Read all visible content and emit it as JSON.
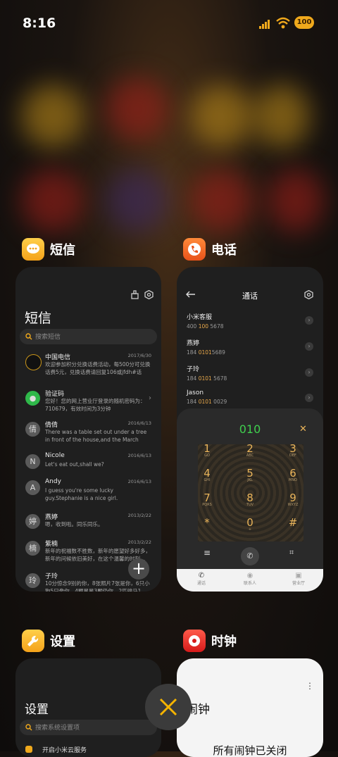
{
  "status": {
    "time": "8:16",
    "battery": "100"
  },
  "apps": {
    "sms": {
      "name": "短信",
      "title": "短信",
      "search_placeholder": "搜索短信",
      "messages": [
        {
          "avatar": "",
          "name": "中国电信",
          "date": "2017/6/30",
          "body": "欢迎参加积分兑换话费活动，每500分可兑换话费5元，兑换话费请回复106或jfdh#话费..."
        },
        {
          "avatar": "",
          "name": "验证码",
          "date": "",
          "body": "您好！您的网上营业厅登录的随机密码为：710679，有效时间为3分钟"
        },
        {
          "avatar": "倩",
          "name": "倩倩",
          "date": "2016/6/13",
          "body": "There was a table set out under a tree in front of the house,and the March Hare an..."
        },
        {
          "avatar": "N",
          "name": "Nicole",
          "date": "2016/6/13",
          "body": "Let's eat out,shall we?"
        },
        {
          "avatar": "A",
          "name": "Andy",
          "date": "2016/6/13",
          "body": "I guess you're some lucky guy.Stephanie is a nice girl."
        },
        {
          "avatar": "婷",
          "name": "燕婷",
          "date": "2013/2/22",
          "body": "嗯，收到啦。同乐同乐。"
        },
        {
          "avatar": "楠",
          "name": "紫楠",
          "date": "2013/2/22",
          "body": "新年的祝福数不胜数，新年的愿望好多好多，新年的问候依旧美好，在这个温馨的时刻..."
        },
        {
          "avatar": "玲",
          "name": "子玲",
          "date": "",
          "body": "10分惊念9别的你，8张照片7张是你，6只小狗5只像你，4颗星星3颗仍你，2匹骏马1..."
        }
      ]
    },
    "phone": {
      "name": "电话",
      "title": "通话",
      "contacts": [
        {
          "name": "小米客服",
          "pre": "400 ",
          "hl": "100",
          "post": " 5678"
        },
        {
          "name": "燕婷",
          "pre": "184 ",
          "hl": "0101",
          "post": "5689"
        },
        {
          "name": "子玲",
          "pre": "184 ",
          "hl": "0101",
          "post": " 5678"
        },
        {
          "name": "Jason",
          "pre": "184 ",
          "hl": "0101",
          "post": " 0029"
        }
      ],
      "dial_number": "010",
      "keys": [
        {
          "d": "1",
          "l": "GO"
        },
        {
          "d": "2",
          "l": "ABC"
        },
        {
          "d": "3",
          "l": "DEF"
        },
        {
          "d": "4",
          "l": "GHI"
        },
        {
          "d": "5",
          "l": "JKL"
        },
        {
          "d": "6",
          "l": "MNO"
        },
        {
          "d": "7",
          "l": "PQRS"
        },
        {
          "d": "8",
          "l": "TUV"
        },
        {
          "d": "9",
          "l": "WXYZ"
        },
        {
          "d": "*",
          "l": ""
        },
        {
          "d": "0",
          "l": "+"
        },
        {
          "d": "#",
          "l": ""
        }
      ],
      "tabs": [
        "通话",
        "联系人",
        "营业厅"
      ]
    },
    "settings": {
      "name": "设置",
      "title": "设置",
      "search_placeholder": "搜索系统设置项",
      "first_item": "开启小米云服务"
    },
    "clock": {
      "name": "时钟",
      "title": "闹钟",
      "status": "所有闹钟已关闭"
    }
  },
  "colors": {
    "accent": "#f5b400",
    "dial_green": "#3fcf4e",
    "highlight": "#e8a84a"
  }
}
